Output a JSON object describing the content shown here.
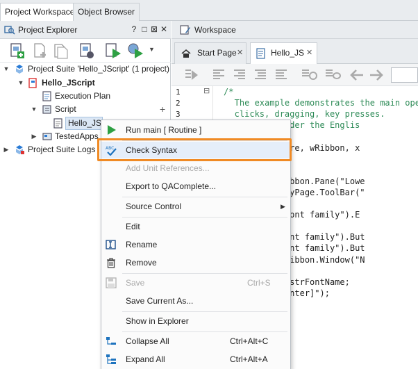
{
  "top_tabs": [
    "Project Workspace",
    "Object Browser"
  ],
  "explorer": {
    "title": "Project Explorer",
    "header_buttons": [
      "?",
      "□",
      "⊠",
      "✕"
    ]
  },
  "tree": {
    "suite": "Project Suite 'Hello_JScript' (1 project)",
    "project": "Hello_JScript",
    "execution_plan": "Execution Plan",
    "script": "Script",
    "hello_js": "Hello_JS",
    "tested_apps": "TestedApps",
    "suite_logs": "Project Suite Logs",
    "add": "+"
  },
  "workspace": {
    "title": "Workspace",
    "tabs": [
      "Start Page",
      "Hello_JS"
    ],
    "close": "✕"
  },
  "editor": {
    "line_numbers": [
      "1",
      "2",
      "3"
    ],
    "fold": "⊟",
    "lines": [
      {
        "text": "/*",
        "cls": "cmt"
      },
      {
        "text": "   The example demonstrates the main oper",
        "cls": "cmt"
      },
      {
        "text": "   clicks, dragging, key presses.",
        "cls": "cmt"
      },
      {
        "text": "  orks only under the Englis",
        "cls": "cmt"
      },
      {
        "text": "",
        "cls": ""
      },
      {
        "text": "  tring(wPicture, wRibbon, x",
        "cls": ""
      },
      {
        "text": "",
        "cls": ""
      },
      {
        "text": "  ck(x, y);",
        "cls": ""
      },
      {
        "text": "  tyPage = wRibbon.Pane(\"Lowe",
        "cls": ""
      },
      {
        "text": "  x = wPropertyPage.ToolBar(\"",
        "cls": ""
      },
      {
        "text": "",
        "cls": ""
      },
      {
        "text": "  .ComboBox(\"Font family\").E",
        "cls": ""
      },
      {
        "text": "",
        "cls": ""
      },
      {
        "text": "  ComboBox(\"Font family\").But",
        "cls": ""
      },
      {
        "text": "  ComboBox(\"Font family\").But",
        "cls": ""
      },
      {
        "text": "  ameEdit = wRibbon.Window(\"N",
        "cls": ""
      },
      {
        "text": "  dit.Click();",
        "cls": ""
      },
      {
        "text": "  dit.wText = strFontName;",
        "cls": ""
      },
      {
        "text": "  dit.Keys(\"[Enter]\");",
        "cls": ""
      }
    ]
  },
  "menu": {
    "run_main": "Run main  [ Routine ]",
    "check_syntax": "Check Syntax",
    "add_unit_refs": "Add Unit References...",
    "export_qacomplete": "Export to QAComplete...",
    "source_control": "Source Control",
    "edit": "Edit",
    "rename": "Rename",
    "remove": "Remove",
    "save": "Save",
    "save_shortcut": "Ctrl+S",
    "save_current_as": "Save Current As...",
    "show_in_explorer": "Show in Explorer",
    "collapse_all": "Collapse All",
    "collapse_shortcut": "Ctrl+Alt+C",
    "expand_all": "Expand All",
    "expand_shortcut": "Ctrl+Alt+A"
  },
  "colors": {
    "highlight": "#f08a24",
    "run_green": "#2ea043",
    "check_blue": "#1e73be"
  }
}
